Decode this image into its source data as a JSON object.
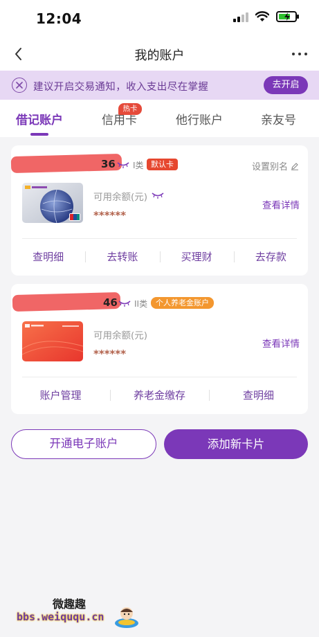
{
  "status_bar": {
    "time": "12:04"
  },
  "nav": {
    "title": "我的账户"
  },
  "notice": {
    "text": "建议开启交易通知，收入支出尽在掌握",
    "button": "去开启"
  },
  "tabs": [
    {
      "label": "借记账户",
      "active": true
    },
    {
      "label": "信用卡",
      "badge": "热卡"
    },
    {
      "label": "他行账户"
    },
    {
      "label": "亲友号"
    }
  ],
  "accounts": [
    {
      "number_suffix": "36",
      "type": "I类",
      "badge": "默认卡",
      "alias_label": "设置别名",
      "balance_label": "可用余额(元)",
      "balance_masked": "******",
      "detail_link": "查看详情",
      "actions": [
        "查明细",
        "去转账",
        "买理财",
        "去存款"
      ]
    },
    {
      "number_suffix": "46",
      "type": "II类",
      "badge": "个人养老金账户",
      "balance_label": "可用余额(元)",
      "balance_masked": "******",
      "detail_link": "查看详情",
      "actions": [
        "账户管理",
        "养老金缴存",
        "查明细"
      ]
    }
  ],
  "buttons": {
    "open_e_account": "开通电子账户",
    "add_card": "添加新卡片"
  },
  "watermark": {
    "title": "微趣趣",
    "url": "bbs.weiququ.cn"
  },
  "colors": {
    "accent": "#7b38b8",
    "notice_bg": "#e7d8f4",
    "badge_red": "#e6472f",
    "badge_orange": "#f3972f",
    "redaction": "#ef5a5a"
  }
}
